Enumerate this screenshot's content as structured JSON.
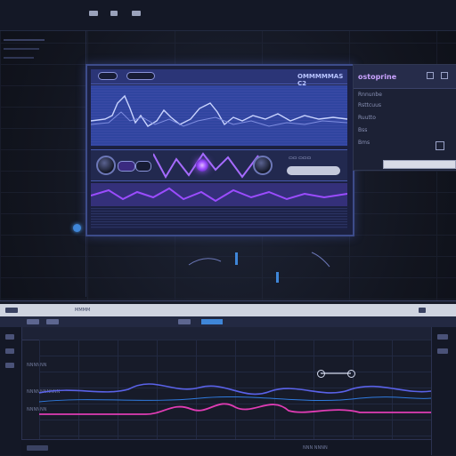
{
  "plugin": {
    "name": "OMMMMMAS C2",
    "accent_color": "#9a4cff",
    "wave_color": "#b9c6ff",
    "controls_label": "▭▭ ▭▭▭"
  },
  "right_panel": {
    "title": "ostoprine",
    "lines": [
      "Rnnunbe",
      "Rsttcuus",
      "Ruutto",
      "Bss",
      "Bms"
    ],
    "header_icons": [
      "minus-icon",
      "restore-icon"
    ]
  },
  "daw": {
    "toolbar_label": "MMMM",
    "status_label": "NNN NNNN",
    "track_names": [
      "NNNNNN",
      "NNNNNNNNNN",
      "NNNNNN"
    ],
    "series_colors": [
      "#5a62e8",
      "#e03cb4",
      "#2f7be0"
    ]
  },
  "icons": {
    "orb": "purple-orb-icon",
    "side_dot": "status-dot-icon"
  }
}
